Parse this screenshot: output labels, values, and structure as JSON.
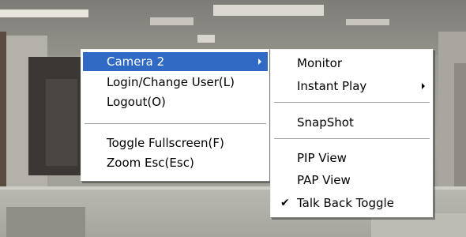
{
  "main_menu": {
    "items": [
      {
        "label": "Camera 2",
        "has_submenu": true,
        "highlighted": true
      },
      {
        "label": "Login/Change User(L)"
      },
      {
        "label": "Logout(O)"
      },
      {
        "label": "Toggle Fullscreen(F)"
      },
      {
        "label": "Zoom Esc(Esc)"
      }
    ]
  },
  "camera_submenu": {
    "items": [
      {
        "label": "Monitor"
      },
      {
        "label": "Instant Play",
        "has_submenu": true
      },
      {
        "label": "SnapShot"
      },
      {
        "label": "PIP View"
      },
      {
        "label": "PAP View"
      },
      {
        "label": "Talk Back Toggle",
        "checked": true
      }
    ],
    "check_mark": "✔"
  },
  "colors": {
    "menu_highlight": "#316ac5",
    "menu_background": "#ffffff",
    "menu_text": "#000000"
  }
}
